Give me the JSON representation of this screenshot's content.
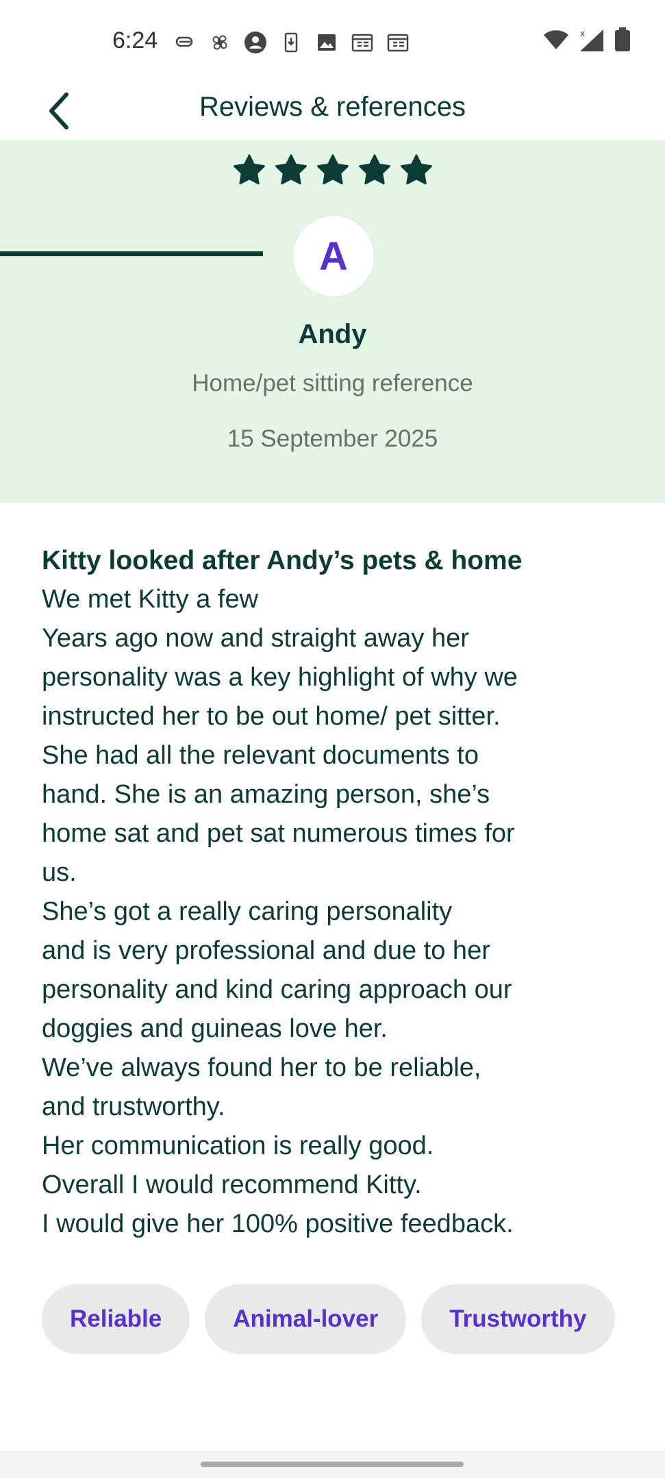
{
  "status_bar": {
    "time": "6:24",
    "icons": [
      "link-icon",
      "fan-icon",
      "account-icon",
      "download-icon",
      "image-icon",
      "calendar-icon",
      "calendar-icon"
    ],
    "right_icons": [
      "wifi-icon",
      "signal-icon",
      "battery-icon"
    ]
  },
  "header": {
    "back_icon": "chevron-left-icon",
    "title": "Reviews & references"
  },
  "hero": {
    "rating": 5,
    "avatar_letter": "A",
    "name": "Andy",
    "type": "Home/pet sitting reference",
    "date": "15 September 2025",
    "background": "#e3f6e6"
  },
  "review": {
    "heading": "Kitty looked after Andy’s pets & home",
    "lines": [
      "We met Kitty a few",
      "Years ago now and straight away her",
      "personality was a key highlight of why we",
      "instructed her to be out home/ pet sitter.",
      "She had all the relevant documents to",
      "hand. She is an amazing person, she’s",
      "home sat and pet sat numerous times for",
      "us.",
      "She’s got a really caring personality",
      "and is very professional and due to her",
      "personality and kind caring approach our",
      "doggies and guineas love her.",
      "We’ve always found her to be reliable,",
      "and trustworthy.",
      "Her communication is really good.",
      "Overall I would recommend Kitty.",
      "I would give her 100% positive feedback."
    ]
  },
  "tags": [
    "Reliable",
    "Animal-lover",
    "Trustworthy"
  ],
  "colors": {
    "primary_text": "#0c3b35",
    "accent": "#5a2fcf",
    "tag_bg": "#e8eaea"
  }
}
